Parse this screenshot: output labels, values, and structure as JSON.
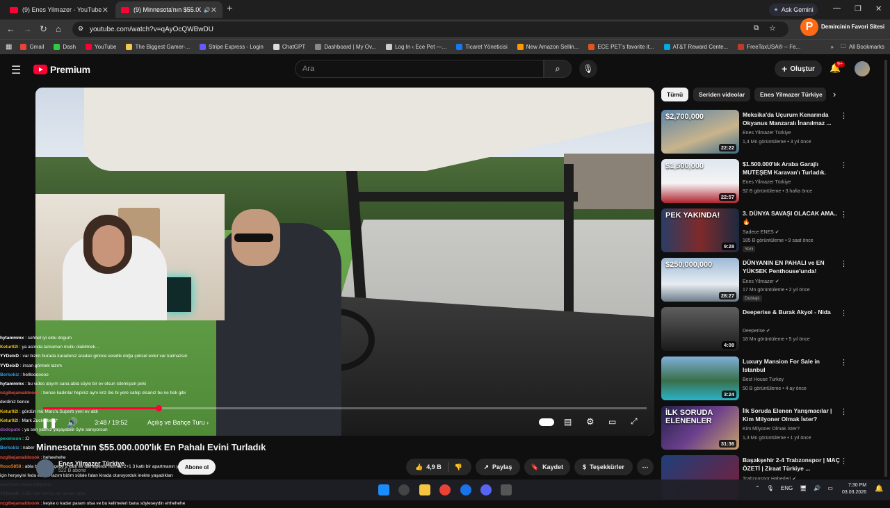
{
  "browser": {
    "tabs": [
      {
        "title": "(9) Enes Yilmazer - YouTube",
        "active": false
      },
      {
        "title": "(9) Minnesota'nın $55.000.0",
        "active": true
      }
    ],
    "ask_gemini": "Ask Gemini",
    "url": "youtube.com/watch?v=qAyOcQWBwDU",
    "profile_initial": "P",
    "profile_name": "Demircinin Favori Sitesi",
    "bookmarks": [
      {
        "label": "Gmail",
        "color": "#ea4335"
      },
      {
        "label": "Dash",
        "color": "#2ecc40"
      },
      {
        "label": "YouTube",
        "color": "#ff0033"
      },
      {
        "label": "The Biggest Gamer-...",
        "color": "#f2c94c"
      },
      {
        "label": "Stripe Express - Login",
        "color": "#635bff"
      },
      {
        "label": "ChatGPT",
        "color": "#dddddd"
      },
      {
        "label": "Dashboard | My Ov...",
        "color": "#888888"
      },
      {
        "label": "Log In ‹ Ece Pet —...",
        "color": "#cccccc"
      },
      {
        "label": "Ticaret Yöneticisi",
        "color": "#1877f2"
      },
      {
        "label": "New Amazon Sellin...",
        "color": "#ff9900"
      },
      {
        "label": "ECE PET's favorite it...",
        "color": "#e2541f"
      },
      {
        "label": "AT&T Reward Cente...",
        "color": "#00a8e0"
      },
      {
        "label": "FreeTaxUSA® -- Fe...",
        "color": "#c0392b"
      }
    ],
    "all_bookmarks": "All Bookmarks"
  },
  "youtube": {
    "logo_text": "Premium",
    "search_placeholder": "Ara",
    "create_label": "Oluştur",
    "notification_count": "9+"
  },
  "player": {
    "time": "3:48 / 19:52",
    "chapter": "Açılış ve Bahçe Turu",
    "progress": 0.191
  },
  "video": {
    "title": "Minnesota'nın $55.000.000'lık En Pahalı Evini Turladık",
    "channel": "Enes Yilmazer Türkiye",
    "subs": "522 B abone",
    "subscribe": "Abone ol",
    "likes": "4,9 B",
    "share": "Paylaş",
    "save": "Kaydet",
    "thanks": "Teşekkürler"
  },
  "chat": [
    {
      "user": "hytammmx",
      "text": "sohbet iyi oldu dogum",
      "color": "#ffffff"
    },
    {
      "user": "Ketur92I",
      "text": "ya aslında tamamen mutlu olabilmek...",
      "color": "#f1c40f"
    },
    {
      "user": "YYDeixD",
      "text": "var bizim burada karadeniz aradan girince vesidik doğa çoksel evler var kalmazsın",
      "color": "#ffffff"
    },
    {
      "user": "YYDeixD",
      "text": "insan görmek lazım",
      "color": "#ffffff"
    },
    {
      "user": "Berkobiz",
      "text": "helllooooooo",
      "color": "#3498db"
    },
    {
      "user": "hytammmx",
      "text": "bu video atıyım sana abla söyle bir ev olsun istemişsin peki",
      "color": "#ffffff"
    },
    {
      "user": "nzgibejamaldoook",
      "text": "bence kadınlar hepiniz aynı kriz öle bi yere sahip olsanız bu ne bok gibi",
      "color": "#e74c3c"
    },
    {
      "user": "",
      "text": "derdiniz bence",
      "color": "#ffffff"
    },
    {
      "user": "Ketur92I",
      "text": "gördün mü Marc'a Superb yeni ev aldı",
      "color": "#f1c40f"
    },
    {
      "user": "Ketur92I",
      "text": "Mark Zuckerberg*",
      "color": "#f1c40f"
    },
    {
      "user": "dodopato",
      "text": "ya sen yalınız yaşayabilir öyle sanıyorsun",
      "color": "#9b59b6"
    },
    {
      "user": "pexenson",
      "text": ":D",
      "color": "#1abc9c"
    },
    {
      "user": "Berkobiz",
      "text": "naber",
      "color": "#3498db"
    },
    {
      "user": "nzgibejamaldoook",
      "text": "heheehehe",
      "color": "#e74c3c"
    },
    {
      "user": "flooo5858",
      "text": "abla bizim bahçede 2 katlı ev dikmişlerdir normal 2+1 3 katlı bir apartmanın yarısı kadar",
      "color": "#e67e22"
    },
    {
      "user": "",
      "text": "için herşeyini feda etmen lazım bizim sülale falan kirada oturuyorduk inekte yaşadıkları",
      "color": "#ffffff"
    },
    {
      "user": "",
      "text": "apartman orada kalıyoruz",
      "color": "#ffffff"
    },
    {
      "user": "YYDeixD",
      "text": "ABD den dönüş ne zaman abla",
      "color": "#ffffff"
    },
    {
      "user": "nzgibejamaldoook",
      "text": "keşke o kadar param olsa ve bu kelimeleri bana söyleseydin ehhehehe",
      "color": "#e74c3c"
    }
  ],
  "chips": [
    "Tümü",
    "Seriden videolar",
    "Enes Yilmazer Türkiye"
  ],
  "recommendations": [
    {
      "title": "Meksika'da Uçurum Kenarında Okyanus Manzaralı İnanılmaz ...",
      "channel": "Enes Yilmazer Türkiye",
      "meta": "1,4 Mn görüntüleme • 3 yıl önce",
      "duration": "22:22",
      "thumb_text": "$2,700,000",
      "thumb_bg": "linear-gradient(160deg,#5b84a8,#c9b48c 60%,#3e6d8a)",
      "badge": "",
      "verified": false
    },
    {
      "title": "$1.500.000'lık Araba Garajlı MUTEŞEM Karavan'ı Turladık.",
      "channel": "Enes Yilmazer Türkiye",
      "meta": "92 B görüntüleme • 3 hafta önce",
      "duration": "22:57",
      "thumb_text": "$1,500,000",
      "thumb_bg": "linear-gradient(180deg,#dfe6ee,#f4f4f4 55%,#b02430)",
      "badge": "",
      "verified": false
    },
    {
      "title": "3. DÜNYA SAVAŞI OLACAK AMA.. 🔥",
      "channel": "Sadece ENES",
      "meta": "185 B görüntüleme • 9 saat önce",
      "duration": "9:28",
      "thumb_text": "PEK YAKINDA!",
      "thumb_bg": "linear-gradient(90deg,#2a3d66,#7f2a2a 50%,#1c2940)",
      "badge": "Yeni",
      "verified": true
    },
    {
      "title": "DÜNYANIN EN PAHALI ve EN YÜKSEK Penthouse'unda!",
      "channel": "Enes Yilmazer",
      "meta": "17 Mn görüntüleme • 2 yıl önce",
      "duration": "28:27",
      "thumb_text": "$250,000,000",
      "thumb_bg": "linear-gradient(180deg,#9db9d6,#e7edf2 60%,#6e7d8a)",
      "badge": "Dublajlı",
      "verified": true
    },
    {
      "title": "Deeperise & Burak Akyol - Nida",
      "channel": "Deeperise",
      "meta": "18 Mn görüntüleme • 5 yıl önce",
      "duration": "4:08",
      "thumb_text": "",
      "thumb_bg": "linear-gradient(180deg,#5e5e5e,#1a1a1a)",
      "badge": "",
      "verified": true
    },
    {
      "title": "Luxury Mansion For Sale in Istanbul",
      "channel": "Best House Turkey",
      "meta": "50 B görüntüleme • 4 ay önce",
      "duration": "3:24",
      "thumb_text": "",
      "thumb_bg": "linear-gradient(180deg,#7fb0d8,#3a6f4b 55%,#2bb3c8)",
      "badge": "",
      "verified": false
    },
    {
      "title": "İlk Soruda Elenen Yarışmacılar | Kim Milyoner Olmak İster?",
      "channel": "Kim Milyoner Olmak İster?",
      "meta": "1,3 Mn görüntüleme • 1 yıl önce",
      "duration": "31:36",
      "thumb_text": "İLK SORUDA ELENENLER",
      "thumb_bg": "linear-gradient(135deg,#22224a,#6b3f8c 50%,#c7a06b)",
      "badge": "",
      "verified": false
    },
    {
      "title": "Başakşehir 2-4 Trabzonspor | MAÇ ÖZETİ | Ziraat Türkiye ...",
      "channel": "Trabzonspor Haberleri",
      "meta": "",
      "duration": "",
      "thumb_text": "",
      "thumb_bg": "linear-gradient(135deg,#1d3f7a,#7a1e3a)",
      "badge": "",
      "verified": true
    }
  ],
  "taskbar": {
    "lang": "ENG",
    "time": "7:30 PM",
    "date": "03.03.2026"
  }
}
